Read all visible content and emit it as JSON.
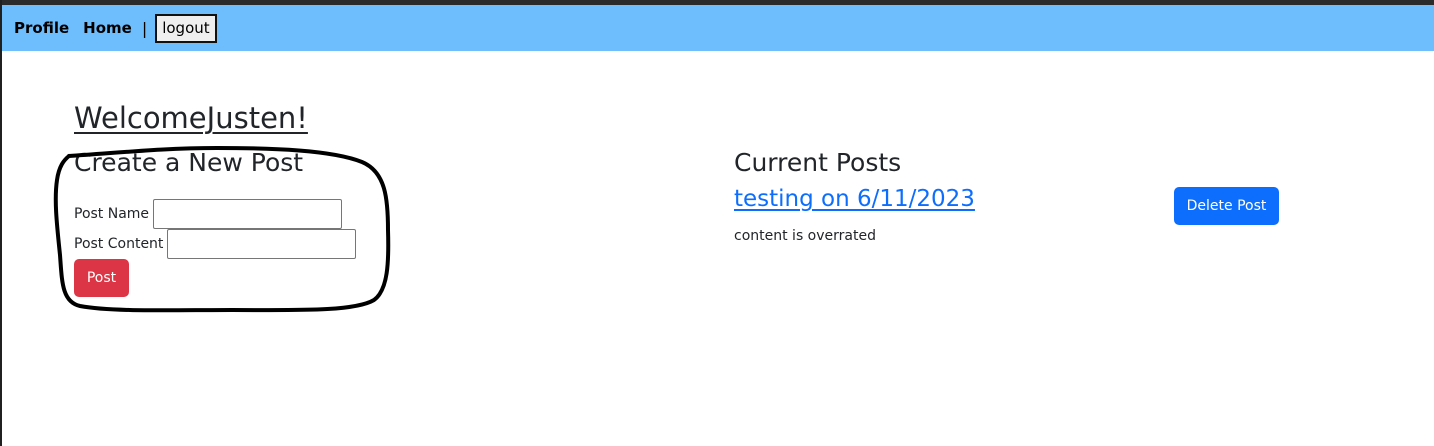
{
  "nav": {
    "profile_label": "Profile",
    "home_label": "Home",
    "separator": "|",
    "logout_label": "logout"
  },
  "main": {
    "welcome_text": "WelcomeJusten!",
    "create_heading": "Create a New Post",
    "form": {
      "post_name_label": "Post Name",
      "post_name_value": "",
      "post_content_label": "Post Content",
      "post_content_value": "",
      "submit_label": "Post"
    },
    "current_heading": "Current Posts",
    "posts": [
      {
        "title": "testing on 6/11/2023",
        "content": "content is overrated",
        "delete_label": "Delete Post"
      }
    ]
  },
  "colors": {
    "navbar_bg": "#6ebdfd",
    "post_button": "#dc3545",
    "delete_button": "#0d6efd",
    "link": "#0d6efd"
  }
}
